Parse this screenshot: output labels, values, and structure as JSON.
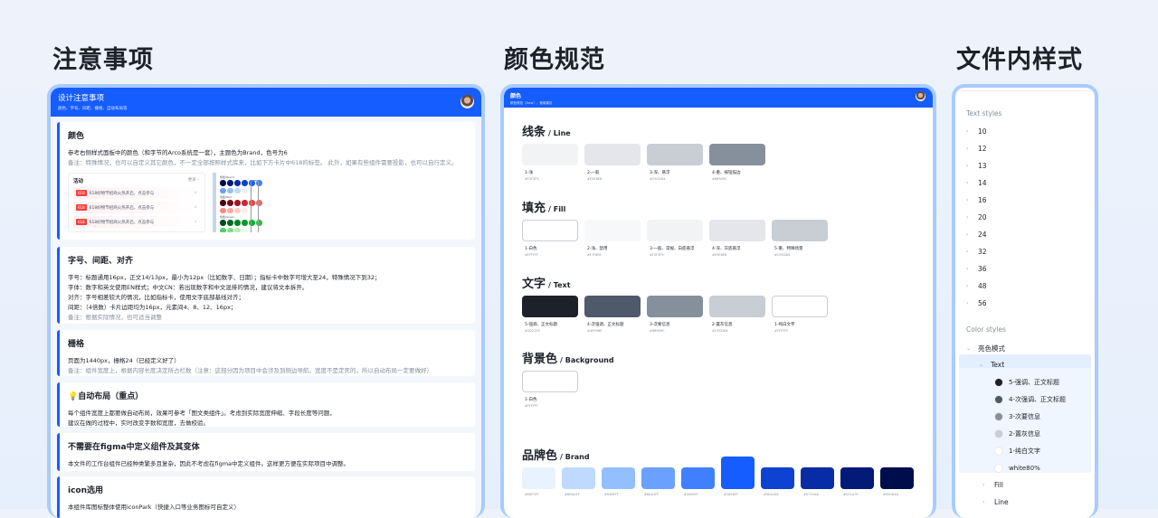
{
  "titles": {
    "notes": "注意事项",
    "colors": "颜色规范",
    "styles": "文件内样式"
  },
  "notes_panel": {
    "header_title": "设计注意事项",
    "header_sub": "颜色、字号、间距、栅格、自动布局等",
    "cards": [
      {
        "title": "颜色",
        "lines": [
          "参考右侧样式面板中的颜色（和字节的Arco系统是一套），主题色为Brand，色号为6"
        ],
        "notes": [
          "备注：特殊情况，也可以自定义其它颜色，不一定全部按照样式库来，比如下方卡片中618的标签。 此外，如果有些组件需要投影，也可以自行定义。"
        ]
      },
      {
        "title": "字号、间距、对齐",
        "lines": [
          "字号：标题通用16px，正文14/13px，最小为12px（比如数字、日期）；指标卡中数字可增大至24，特殊情况下到32；",
          "字体：数字和英文使用EN样式；中文CN：若出现数字和中文混排的情况，建议将文本拆开。",
          "对齐：字号相差较大的情况，比如指标卡，使用文字底部基线对齐；",
          "间距：（4倍数）卡片边距均为16px，元素间4、8、12、16px；"
        ],
        "notes": [
          "备注：根据实际情况，也可适当调整"
        ]
      },
      {
        "title": "栅格",
        "lines": [
          "页面为1440px，栅格24（已经定义好了）"
        ],
        "notes": [
          "备注：组件宽度上，根据内容长度决定所占栏数（注意：这部分因为项目中会涉及到侧边导航，宽度不是定死的，所以自动布局一定要做好）"
        ]
      },
      {
        "title": "💡自动布局（重点）",
        "lines": [
          "每个组件宽度上都要做自动布局，效果可参考「图文类组件」。考虑到实际宽度伸缩、字段长度等问题，",
          "建议在做的过程中，实时改变字数和宽度，去做校验。"
        ],
        "notes": []
      },
      {
        "title": "不需要在figma中定义组件及其变体",
        "lines": [
          "本文件的工作台组件已经种类繁多且复杂，因此不考虑在figma中定义组件。这样更方便在实际项目中调整。"
        ],
        "notes": []
      },
      {
        "title": "icon选用",
        "lines": [
          "本组件库图标整体使用iconPark（快捷入口等业务图标可自定义）"
        ],
        "notes": []
      }
    ],
    "activity": {
      "title": "活动",
      "more": "更多 ›",
      "tag": "618",
      "rows": [
        "618好物节招商火热开启，点击参与",
        "618好物节招商火热开启，点击参与",
        "618好物节招商火热开启，点击参与"
      ]
    },
    "palette": {
      "labels": [
        "色板/Brand",
        "色板/Red",
        "色板/Green"
      ],
      "rows": [
        [
          "#000d4d",
          "#031a79",
          "#072ca6",
          "#0e42d2",
          "#165dff",
          "#4080ff"
        ],
        [
          "#6aa1ff",
          "#94bfff",
          "#bedaff",
          "#e8f3ff",
          "#f2f7ff"
        ],
        [
          "#4d000a",
          "#77081d",
          "#a1151e",
          "#cb2634",
          "#f53f3f",
          "#f76560"
        ],
        [
          "#f98981",
          "#fbaca3",
          "#fdcdc5",
          "#ffece8"
        ],
        [
          "#004d1c",
          "#006622",
          "#008026",
          "#009a29",
          "#00b42a",
          "#23c343"
        ],
        [
          "#4cd263",
          "#7be188",
          "#aff0b5",
          "#e8ffea"
        ]
      ]
    }
  },
  "colors_panel": {
    "header_title": "颜色",
    "header_sub": "颜色规范（Arco），使用建议",
    "sections": [
      {
        "title": "线条",
        "en": "/ Line",
        "items": [
          {
            "label": "1-浅",
            "hex": "#F2F3F5"
          },
          {
            "label": "2-一般",
            "hex": "#E5E6EB"
          },
          {
            "label": "3-深、悬浮",
            "hex": "#C9CDD4"
          },
          {
            "label": "4-重、按钮描边",
            "hex": "#86909C"
          }
        ]
      },
      {
        "title": "填充",
        "en": "/ Fill",
        "items": [
          {
            "label": "1-白色",
            "hex": "#FFFFFF"
          },
          {
            "label": "2-浅、禁用",
            "hex": "#F7F8FA"
          },
          {
            "label": "3-一般、常规、白底悬浮",
            "hex": "#F2F3F5"
          },
          {
            "label": "4-深、灰底悬浮",
            "hex": "#E5E6EB"
          },
          {
            "label": "5-重、特殊场景",
            "hex": "#C9CDD4"
          }
        ]
      },
      {
        "title": "文字",
        "en": "/ Text",
        "items": [
          {
            "label": "5-强调、正文标题",
            "hex": "#1D2129"
          },
          {
            "label": "4-次强调、正文标题",
            "hex": "#4E5969"
          },
          {
            "label": "3-次要信息",
            "hex": "#86909C"
          },
          {
            "label": "2-置灰信息",
            "hex": "#C9CDD4"
          },
          {
            "label": "1-纯白文字",
            "hex": "#FFFFFF"
          }
        ]
      },
      {
        "title": "背景色",
        "en": "/ Background",
        "items": [
          {
            "label": "1-白色",
            "hex": "#FFFFFF"
          }
        ]
      }
    ],
    "brand": {
      "title": "品牌色",
      "en": "/ Brand",
      "selected_index": 5,
      "items": [
        "#E8F3FF",
        "#BEDAFF",
        "#94BFFF",
        "#6AA1FF",
        "#4080FF",
        "#165DFF",
        "#0E42D2",
        "#072CA6",
        "#031A79",
        "#000D4D"
      ]
    }
  },
  "styles_panel": {
    "text_styles_label": "Text styles",
    "text_styles": [
      "10",
      "12",
      "13",
      "14",
      "16",
      "20",
      "24",
      "32",
      "36",
      "48",
      "56"
    ],
    "color_styles_label": "Color styles",
    "group": "亮色模式",
    "subgroup": "Text",
    "text_colors": [
      {
        "name": "5-强调、正文标题",
        "hex": "#1D2129"
      },
      {
        "name": "4-次强调、正文标题",
        "hex": "#4E5969"
      },
      {
        "name": "3-次要信息",
        "hex": "#86909C"
      },
      {
        "name": "2-置灰信息",
        "hex": "#C9CDD4"
      },
      {
        "name": "1-纯白文字",
        "hex": "#FFFFFF"
      },
      {
        "name": "white80%",
        "hex": "#FFFFFF"
      }
    ],
    "other_groups": [
      "Fill",
      "Line"
    ]
  }
}
